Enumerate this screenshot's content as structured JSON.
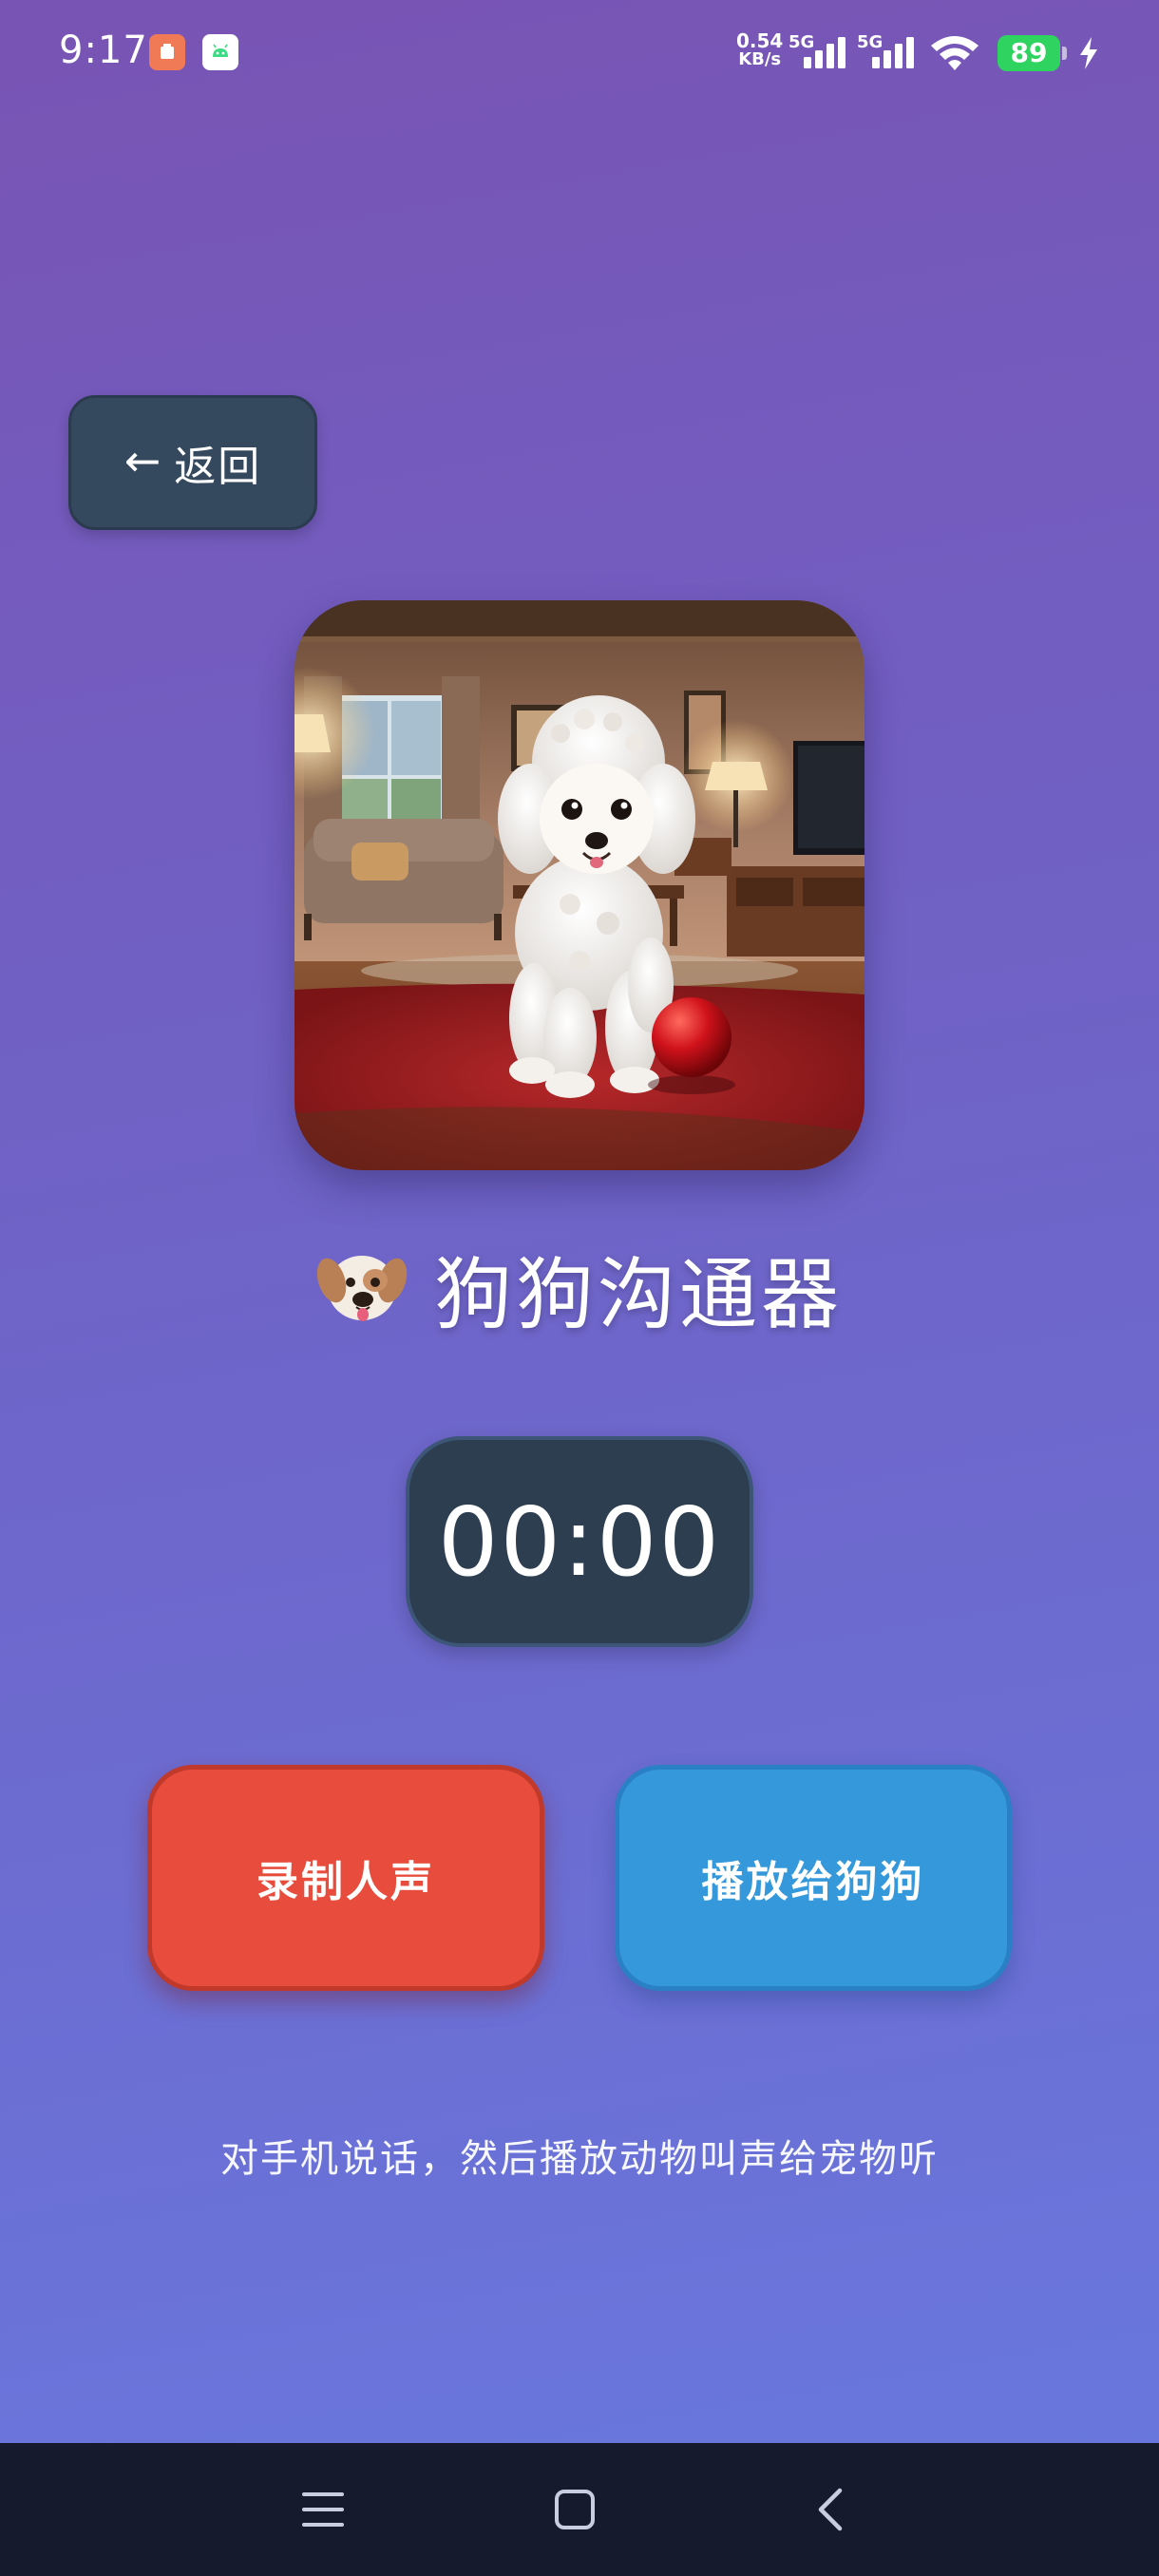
{
  "status_bar": {
    "time": "9:17",
    "net_speed_value": "0.54",
    "net_speed_unit": "KB/s",
    "signal_1_label": "5G",
    "signal_2_label": "5G",
    "battery_level": "89",
    "battery_color": "#2fd35f",
    "icons": [
      "notification-app-icon",
      "android-icon",
      "signal-icon",
      "wifi-icon",
      "battery-icon",
      "charging-icon"
    ]
  },
  "header": {
    "back_arrow": "←",
    "back_label": "返回"
  },
  "hero": {
    "icon": "poodle-photo"
  },
  "title": {
    "emoji": "dog-face-icon",
    "text": "狗狗沟通器"
  },
  "timer": {
    "value": "00:00"
  },
  "actions": {
    "record_label": "录制人声",
    "play_label": "播放给狗狗",
    "record_color": "#e74c3c",
    "play_color": "#3498db"
  },
  "hint": {
    "text": "对手机说话，然后播放动物叫声给宠物听"
  },
  "nav_bar": {
    "icons": [
      "menu-icon",
      "home-icon",
      "back-icon"
    ]
  }
}
